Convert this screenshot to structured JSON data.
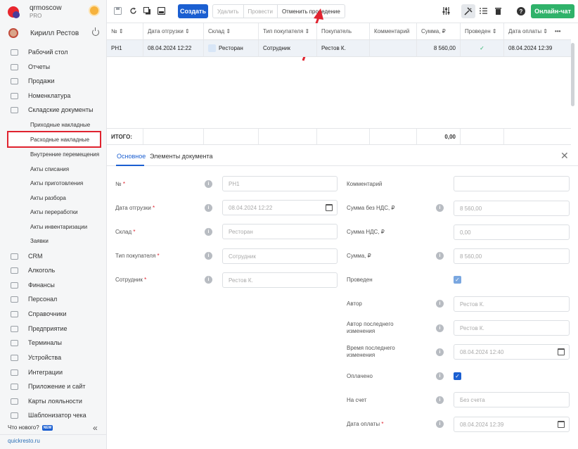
{
  "app": {
    "org_name": "qrmoscow",
    "plan": "PRO",
    "user_name": "Кирилл Рестов",
    "footer_link": "quickresto.ru",
    "whats_new": "Что нового?",
    "new_badge": "NEW"
  },
  "sidebar": {
    "items": [
      {
        "label": "Рабочий стол",
        "icon": "dashboard-icon"
      },
      {
        "label": "Отчеты",
        "icon": "reports-icon"
      },
      {
        "label": "Продажи",
        "icon": "sales-icon"
      },
      {
        "label": "Номенклатура",
        "icon": "catalog-icon"
      },
      {
        "label": "Складские документы",
        "icon": "warehouse-icon"
      }
    ],
    "sub_items": [
      "Приходные накладные",
      "Расходные накладные",
      "Внутренние перемещения",
      "Акты списания",
      "Акты приготовления",
      "Акты разбора",
      "Акты переработки",
      "Акты инвентаризации",
      "Заявки"
    ],
    "lower_items": [
      {
        "label": "CRM",
        "icon": "crm-icon"
      },
      {
        "label": "Алкоголь",
        "icon": "alcohol-icon"
      },
      {
        "label": "Финансы",
        "icon": "finance-icon"
      },
      {
        "label": "Персонал",
        "icon": "staff-icon"
      },
      {
        "label": "Справочники",
        "icon": "directory-icon"
      },
      {
        "label": "Предприятие",
        "icon": "enterprise-icon"
      },
      {
        "label": "Терминалы",
        "icon": "terminal-icon"
      },
      {
        "label": "Устройства",
        "icon": "device-icon"
      },
      {
        "label": "Интеграции",
        "icon": "integration-icon"
      },
      {
        "label": "Приложение и сайт",
        "icon": "app-icon"
      },
      {
        "label": "Карты лояльности",
        "icon": "loyalty-icon"
      },
      {
        "label": "Шаблонизатор чека",
        "icon": "receipt-icon"
      }
    ]
  },
  "toolbar": {
    "create": "Создать",
    "delete": "Удалить",
    "post": "Провести",
    "unpost": "Отменить проведение",
    "chat": "Онлайн-чат",
    "help": "?"
  },
  "table": {
    "headers": [
      "№",
      "Дата отгрузки",
      "Склад",
      "Тип покупателя",
      "Покупатель",
      "Комментарий",
      "Сумма, ₽",
      "Проведен",
      "Дата оплаты"
    ],
    "row": [
      "РН1",
      "08.04.2024 12:22",
      "Ресторан",
      "Сотрудник",
      "Рестов К.",
      "",
      "8 560,00",
      "✓",
      "08.04.2024 12:39"
    ],
    "total_label": "ИТОГО:",
    "total_sum": "0,00"
  },
  "tabs": [
    "Основное",
    "Элементы документа"
  ],
  "form_left": [
    {
      "label": "№",
      "required": "*",
      "value": "РН1"
    },
    {
      "label": "Дата отгрузки",
      "required": "*",
      "value": "08.04.2024 12:22"
    },
    {
      "label": "Склад",
      "required": "*",
      "value": "Ресторан"
    },
    {
      "label": "Тип покупателя",
      "required": "*",
      "value": "Сотрудник"
    },
    {
      "label": "Сотрудник",
      "required": "*",
      "value": "Рестов К."
    }
  ],
  "form_right": [
    {
      "label": "Комментарий",
      "value": ""
    },
    {
      "label": "Сумма без НДС, ₽",
      "value": "8 560,00"
    },
    {
      "label": "Сумма НДС, ₽",
      "value": "0,00"
    },
    {
      "label": "Сумма, ₽",
      "value": "8 560,00"
    },
    {
      "label": "Проведен",
      "value": ""
    },
    {
      "label": "Автор",
      "value": "Рестов К."
    },
    {
      "label": "Автор последнего изменения",
      "value": "Рестов К."
    },
    {
      "label": "Время последнего изменения",
      "value": "08.04.2024 12:40"
    },
    {
      "label": "Оплачено",
      "value": ""
    },
    {
      "label": "На счет",
      "value": "Без счета"
    },
    {
      "label": "Дата оплаты",
      "required": "*",
      "value": "08.04.2024 12:39"
    }
  ],
  "colors": {
    "accent": "#1b5fd1",
    "chat": "#2fb26a",
    "highlight": "#e0232f"
  }
}
